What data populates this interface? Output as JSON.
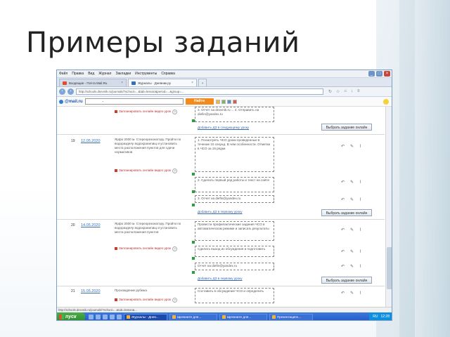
{
  "slide": {
    "title": "Примеры заданий"
  },
  "browser": {
    "menu": [
      "Файл",
      "Правка",
      "Вид",
      "Журнал",
      "Закладки",
      "Инструменты",
      "Справка"
    ],
    "window_controls": {
      "minimize": "_",
      "maximize": "□",
      "close": "×"
    },
    "tabs": [
      {
        "label": "Входящие - Почта Mail.Ru",
        "active": false
      },
      {
        "label": "Журналы · Дневник.ру",
        "active": true
      }
    ],
    "new_tab_label": "+",
    "url": "http://schools.dnevnik.ru/journals/?school=...&tab=lesson&period=...&group=...",
    "search": {
      "brand": "@mail.ru",
      "button_label": "Найти",
      "placeholder": "-"
    }
  },
  "journal": {
    "rows": [
      {
        "num": "",
        "date": "",
        "task": "",
        "video_label": "Запланировать онлайн видео урок",
        "gboxes": [
          "3. Отчет на dnevnik.ru ... 4. Отправить на diefin@yandex.ru"
        ],
        "add_link": "Добавить ДЗ в следующему уроку",
        "select_label": "Выбрать задание онлайн"
      },
      {
        "num": "19",
        "date": "12.05.2020",
        "task": "Ярфо 2000 м. Стереорезонатору. Пройти по водоразделу водохранилищ и установить места расположения пунктов для сдачи нормативов",
        "video_label": "Запланировать онлайн видео урок",
        "gboxes": [
          "1. Посмотреть ЧСО уроки проведенные в течение 10 секунд. В чем особенности. Отметки в ЧСО за 15 рядки",
          "2. Сделать первый ряд работы и текст на сайте",
          "3. Отчет на diefin@yandex.ru"
        ],
        "add_link": "Добавить ДЗ в первому уроку",
        "select_label": "Выбрать задание онлайн"
      },
      {
        "num": "20",
        "date": "14.05.2020",
        "task": "Ярфо 2000 м. Стереорезонатору. Пройти по водоразделу водохранилищ и установить места расположения пунктов",
        "video_label": "Запланировать онлайн видео урок",
        "gboxes": [
          "Провести профилактические задания ЧСО в автоматическом режиме и записать результаты",
          "Сделать выход из обсуждения и подготовить",
          "Отчет на diefin@yandex.ru"
        ],
        "add_link": "Добавить ДЗ в первому уроку",
        "select_label": "Выбрать задание онлайн"
      },
      {
        "num": "21",
        "date": "15.05.2020",
        "task": "Прохождение рубежа",
        "video_label": "Запланировать онлайн видео урок",
        "gboxes": [
          "Составить в обсуждение ЧСО и определить"
        ],
        "add_link": "",
        "select_label": ""
      }
    ]
  },
  "statusbar": "http://schools.dnevnik.ru/journals/?school=...&tab=lesson&...",
  "taskbar": {
    "start_label": "пуск",
    "tasks": [
      "Журналы - Днев...",
      "Щелкните для...",
      "Щелкните для...",
      "Презентация1..."
    ],
    "lang": "RU",
    "clock": "12:28"
  }
}
